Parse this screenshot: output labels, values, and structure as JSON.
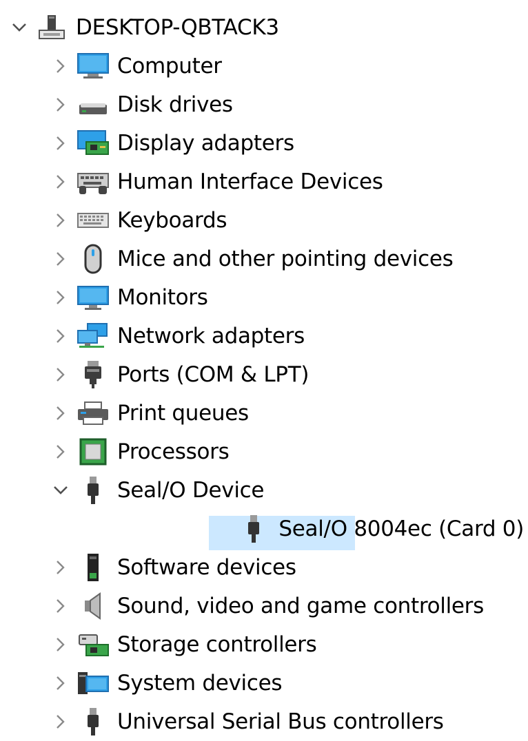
{
  "root": {
    "label": "DESKTOP-QBTACK3",
    "expanded": true,
    "icon": "computer-tower-icon"
  },
  "categories": [
    {
      "label": "Computer",
      "expanded": false,
      "icon": "computer-icon"
    },
    {
      "label": "Disk drives",
      "expanded": false,
      "icon": "disk-drive-icon"
    },
    {
      "label": "Display adapters",
      "expanded": false,
      "icon": "display-adapter-icon"
    },
    {
      "label": "Human Interface Devices",
      "expanded": false,
      "icon": "hid-icon"
    },
    {
      "label": "Keyboards",
      "expanded": false,
      "icon": "keyboard-icon"
    },
    {
      "label": "Mice and other pointing devices",
      "expanded": false,
      "icon": "mouse-icon"
    },
    {
      "label": "Monitors",
      "expanded": false,
      "icon": "monitor-icon"
    },
    {
      "label": "Network adapters",
      "expanded": false,
      "icon": "network-adapter-icon"
    },
    {
      "label": "Ports (COM & LPT)",
      "expanded": false,
      "icon": "port-icon"
    },
    {
      "label": "Print queues",
      "expanded": false,
      "icon": "printer-icon"
    },
    {
      "label": "Processors",
      "expanded": false,
      "icon": "processor-icon"
    },
    {
      "label": "Seal/O Device",
      "expanded": true,
      "icon": "usb-plug-icon",
      "children": [
        {
          "label": "Seal/O 8004ec (Card 0)",
          "selected": true,
          "icon": "usb-plug-icon"
        }
      ]
    },
    {
      "label": "Software devices",
      "expanded": false,
      "icon": "software-device-icon"
    },
    {
      "label": "Sound, video and game controllers",
      "expanded": false,
      "icon": "speaker-icon"
    },
    {
      "label": "Storage controllers",
      "expanded": false,
      "icon": "storage-controller-icon"
    },
    {
      "label": "System devices",
      "expanded": false,
      "icon": "system-devices-icon"
    },
    {
      "label": "Universal Serial Bus controllers",
      "expanded": false,
      "icon": "usb-plug-icon"
    }
  ],
  "colors": {
    "selection": "#cce8ff",
    "chevron": "#707070",
    "monitor_blue": "#2ea0e8",
    "board_green": "#3aa54a"
  }
}
